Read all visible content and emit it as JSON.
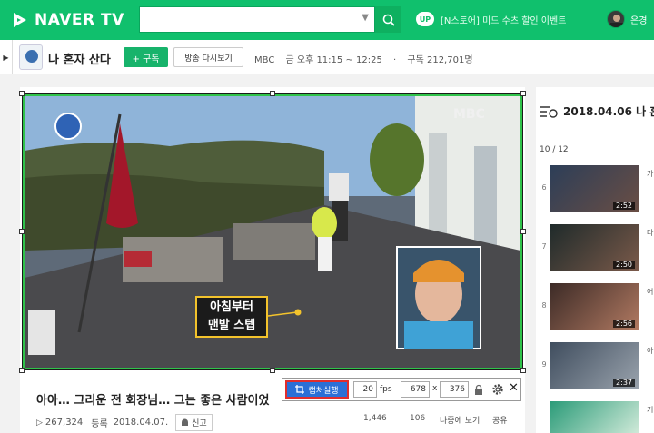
{
  "header": {
    "logo_text": "NAVER TV",
    "search_value": "",
    "up_badge": "UP",
    "promo_text": "[N스토어] 미드 수츠 할인 이벤트",
    "user_name": "은경",
    "brand_color": "#10c06d"
  },
  "channel": {
    "thumb_label": "나 혼자 산다",
    "title": "나 혼자 산다",
    "subscribe_label": "+ 구독",
    "replay_label": "방송 다시보기",
    "broadcaster": "MBC",
    "schedule": "금 오후 11:15 ~ 12:25",
    "subscribers": "구독 212,701명"
  },
  "video": {
    "caption_line1": "아침부터",
    "caption_line2": "맨발 스텝",
    "logo_overlay": "MBC",
    "show_logo": "나 혼자 산다",
    "title": "아아… 그리운 전 회장님… 그는 좋은 사람이었",
    "views": "267,324",
    "registered_label": "등록",
    "registered_date": "2018.04.07.",
    "report_label": "신고"
  },
  "capture_toolbar": {
    "capture_label": "캡처실행",
    "fps_value": "20",
    "fps_label": "fps",
    "width_value": "678",
    "x_label": "x",
    "height_value": "376",
    "close_symbol": "✕"
  },
  "actions": {
    "likes": "1,446",
    "comments": "106",
    "later": "나중에 보기",
    "share": "공유"
  },
  "sidebar": {
    "heading": "2018.04.06 나 혼",
    "count": "10 / 12",
    "items": [
      {
        "num": "6",
        "duration": "2:52",
        "letter": "가"
      },
      {
        "num": "7",
        "duration": "2:50",
        "letter": "다"
      },
      {
        "num": "8",
        "duration": "2:56",
        "letter": "어"
      },
      {
        "num": "9",
        "duration": "2:37",
        "letter": "아"
      },
      {
        "num": "",
        "duration": "",
        "letter": "기"
      }
    ]
  }
}
